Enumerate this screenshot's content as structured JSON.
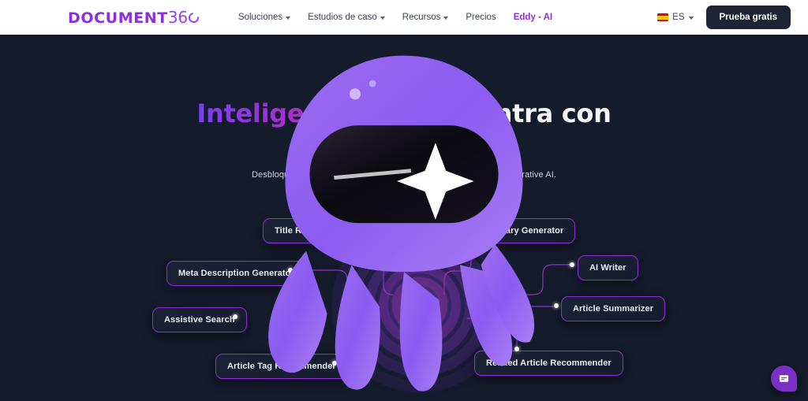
{
  "nav": {
    "logo": {
      "primary": "DOCUMENT",
      "secondary": "36",
      "ring_icon": "circle-o-icon"
    },
    "links": [
      {
        "label": "Soluciones",
        "has_caret": true
      },
      {
        "label": "Estudios de caso",
        "has_caret": true
      },
      {
        "label": "Recursos",
        "has_caret": true
      },
      {
        "label": "Precios",
        "has_caret": false
      },
      {
        "label": "Eddy - AI",
        "has_caret": false,
        "accent": true
      }
    ],
    "language": {
      "code": "ES",
      "flag_icon": "spain-flag-icon",
      "caret_icon": "chevron-down-icon"
    },
    "cta_label": "Prueba gratis"
  },
  "hero": {
    "headline_accent": "Inteligencia",
    "headline_rest": " se encuentra con información",
    "subheadline": "Desbloquea todo el potencial de tu base de conocimientos con Generative AI."
  },
  "diagram": {
    "center_icon": "octopus-ai-mascot",
    "nodes": [
      {
        "id": "title-recommender",
        "label": "Title Recommender"
      },
      {
        "id": "meta-description-generator",
        "label": "Meta Description Generator"
      },
      {
        "id": "assistive-search",
        "label": "Assistive Search"
      },
      {
        "id": "article-tag-recommender",
        "label": "Article Tag Recommender"
      },
      {
        "id": "business-glossary-generator",
        "label": "Business Glossary Generator"
      },
      {
        "id": "ai-writer",
        "label": "AI Writer"
      },
      {
        "id": "article-summarizer",
        "label": "Article Summarizer"
      },
      {
        "id": "related-article-recommender",
        "label": "Related Article Recommender"
      }
    ]
  },
  "chat": {
    "icon": "chat-bubble-icon"
  },
  "colors": {
    "background": "#141b2b",
    "navbar": "#ffffff",
    "brand_purple": "#8b2fe0",
    "accent_magenta": "#c0279f",
    "node_border": "#8e2fd8",
    "cta_bg": "#1d2433"
  }
}
